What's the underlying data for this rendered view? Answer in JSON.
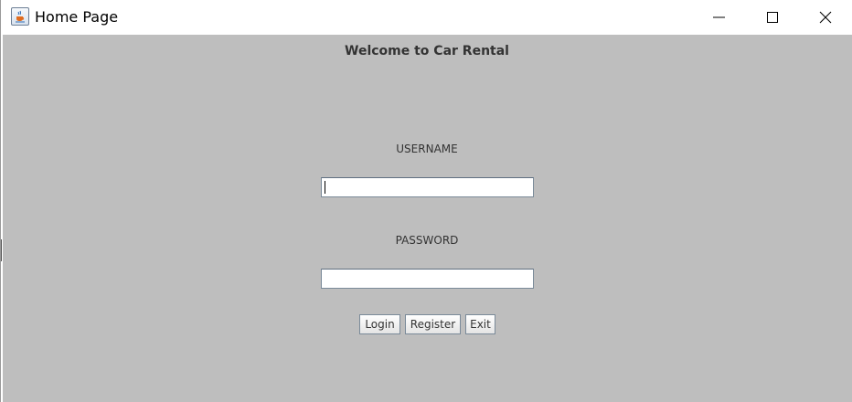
{
  "window": {
    "title": "Home Page",
    "app_icon": "java-cup-icon",
    "controls": {
      "minimize_icon": "minimize-icon",
      "maximize_icon": "maximize-icon",
      "close_icon": "close-icon"
    }
  },
  "form": {
    "heading": "Welcome to Car Rental",
    "username_label": "USERNAME",
    "username_value": "",
    "password_label": "PASSWORD",
    "password_value": "",
    "buttons": {
      "login": "Login",
      "register": "Register",
      "exit": "Exit"
    }
  },
  "colors": {
    "panel_background": "#bebebe",
    "titlebar_background": "#ffffff",
    "text": "#333333"
  }
}
